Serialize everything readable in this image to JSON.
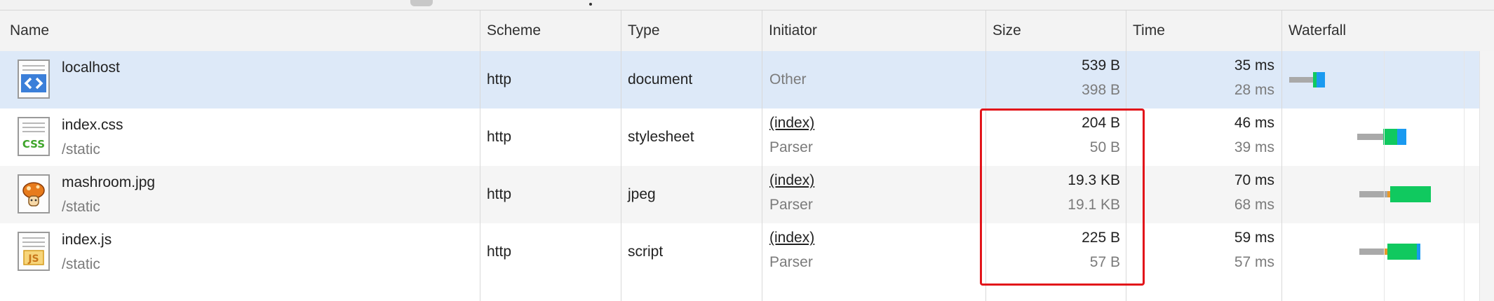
{
  "columns": {
    "name": "Name",
    "scheme": "Scheme",
    "type": "Type",
    "initiator": "Initiator",
    "size": "Size",
    "time": "Time",
    "waterfall": "Waterfall"
  },
  "rows": [
    {
      "name": "localhost",
      "path": "",
      "icon": "html-document-icon",
      "scheme": "http",
      "type": "document",
      "initiator": "Other",
      "initiator_detail": "",
      "size": "539 B",
      "size_content": "398 B",
      "time": "35 ms",
      "latency": "28 ms",
      "selected": true
    },
    {
      "name": "index.css",
      "path": "/static",
      "icon": "css-file-icon",
      "scheme": "http",
      "type": "stylesheet",
      "initiator": "(index)",
      "initiator_detail": "Parser",
      "size": "204 B",
      "size_content": "50 B",
      "time": "46 ms",
      "latency": "39 ms"
    },
    {
      "name": "mashroom.jpg",
      "path": "/static",
      "icon": "image-file-icon",
      "scheme": "http",
      "type": "jpeg",
      "initiator": "(index)",
      "initiator_detail": "Parser",
      "size": "19.3 KB",
      "size_content": "19.1 KB",
      "time": "70 ms",
      "latency": "68 ms"
    },
    {
      "name": "index.js",
      "path": "/static",
      "icon": "js-file-icon",
      "scheme": "http",
      "type": "script",
      "initiator": "(index)",
      "initiator_detail": "Parser",
      "size": "225 B",
      "size_content": "57 B",
      "time": "59 ms",
      "latency": "57 ms"
    }
  ],
  "colors": {
    "selected_row": "#dde9f8",
    "waiting": "#a9a9a9",
    "download": "#10c95f",
    "receive": "#1a9af0",
    "highlight": "#e2141a"
  }
}
